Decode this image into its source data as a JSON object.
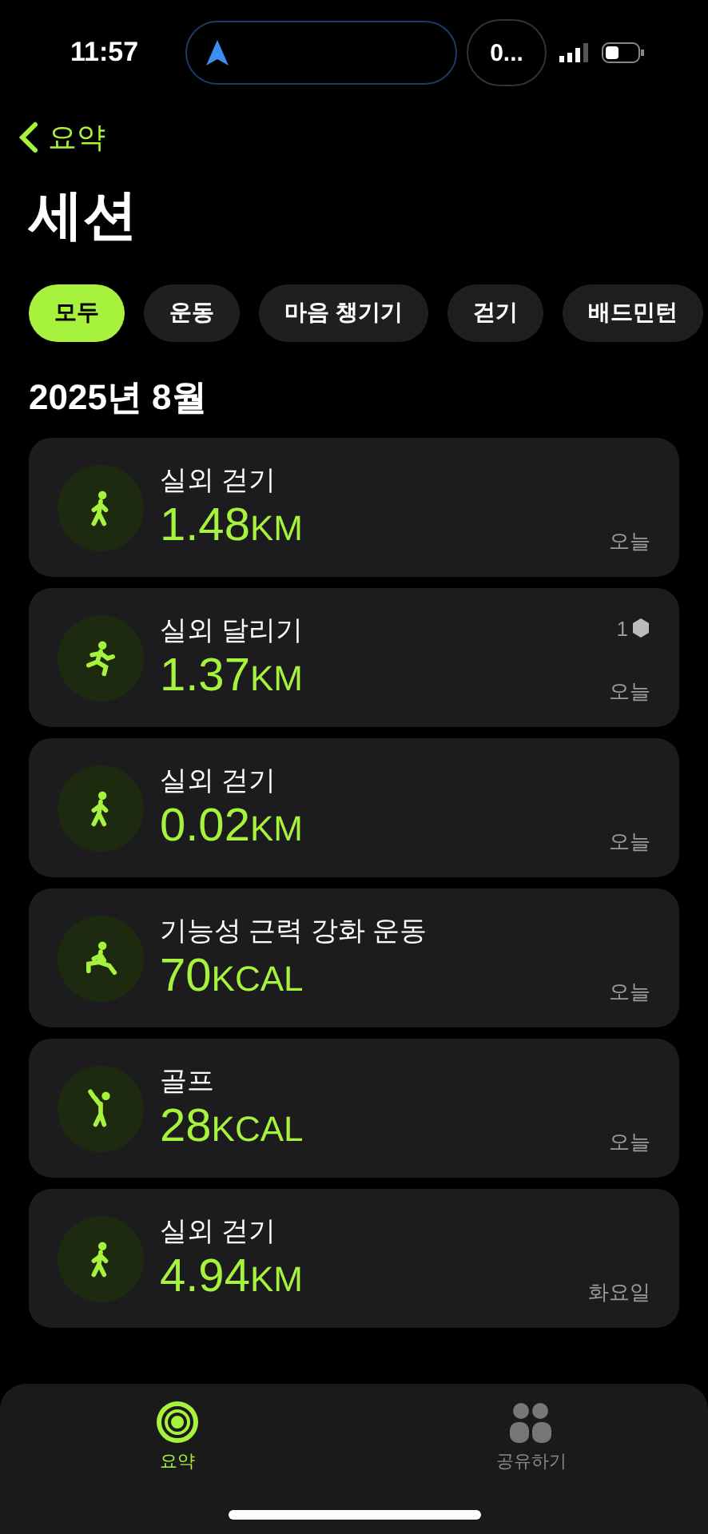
{
  "status_bar": {
    "time": "11:57",
    "activity": "0..."
  },
  "back": {
    "label": "요약"
  },
  "title": "세션",
  "filters": [
    {
      "label": "모두",
      "selected": true
    },
    {
      "label": "운동",
      "selected": false
    },
    {
      "label": "마음 챙기기",
      "selected": false
    },
    {
      "label": "걷기",
      "selected": false
    },
    {
      "label": "배드민턴",
      "selected": false
    }
  ],
  "month": "2025년 8월",
  "sessions": [
    {
      "kind": "walk",
      "name": "실외 걷기",
      "value": "1.48",
      "unit": "KM",
      "date": "오늘"
    },
    {
      "kind": "run",
      "name": "실외 달리기",
      "value": "1.37",
      "unit": "KM",
      "date": "오늘",
      "badge": "1"
    },
    {
      "kind": "walk",
      "name": "실외 걷기",
      "value": "0.02",
      "unit": "KM",
      "date": "오늘"
    },
    {
      "kind": "strength",
      "name": "기능성 근력 강화 운동",
      "value": "70",
      "unit": "KCAL",
      "date": "오늘"
    },
    {
      "kind": "golf",
      "name": "골프",
      "value": "28",
      "unit": "KCAL",
      "date": "오늘"
    },
    {
      "kind": "walk",
      "name": "실외 걷기",
      "value": "4.94",
      "unit": "KM",
      "date": "화요일"
    }
  ],
  "tab_bar": [
    {
      "kind": "summary",
      "label": "요약",
      "selected": true
    },
    {
      "kind": "sharing",
      "label": "공유하기",
      "selected": false
    }
  ]
}
